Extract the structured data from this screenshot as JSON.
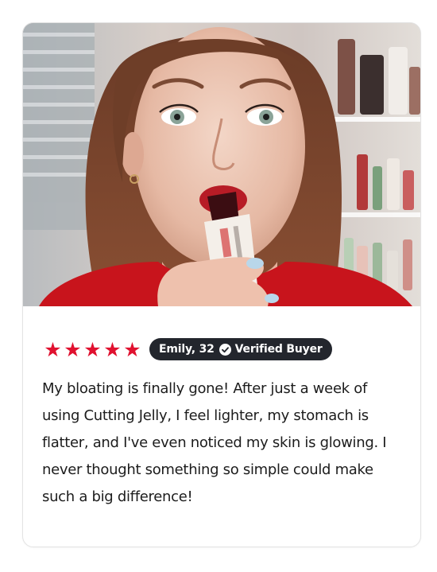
{
  "review": {
    "rating": 5,
    "stars": [
      "★",
      "★",
      "★",
      "★",
      "★"
    ],
    "author": "Emily, 32",
    "verified_label": "Verified Buyer",
    "text": "My bloating is finally gone! After just a week of using Cutting Jelly, I feel lighter, my stomach is flatter, and I've even noticed my skin is glowing. I never thought something so simple could make such a big difference!"
  },
  "icons": {
    "verified": "check-circle-icon",
    "star": "star-icon"
  },
  "colors": {
    "star": "#e0112f",
    "badge_bg": "#23262d",
    "badge_text": "#ffffff",
    "body_text": "#1c1c1c",
    "shirt": "#c8141c"
  }
}
